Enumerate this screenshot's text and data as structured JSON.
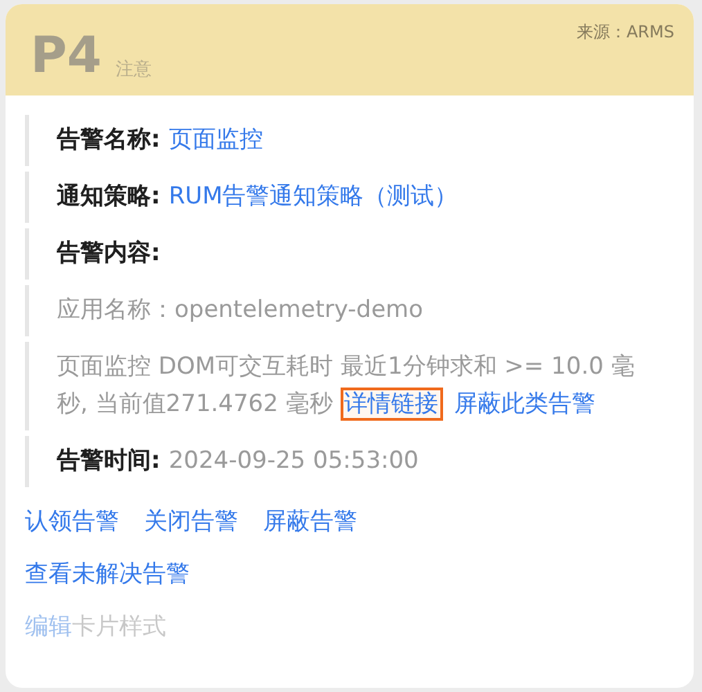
{
  "header": {
    "priority": "P4",
    "severity": "注意",
    "source": "来源：ARMS"
  },
  "fields": [
    {
      "kind": "pair",
      "label": "告警名称:",
      "value": "页面监控",
      "value_is_link": true
    },
    {
      "kind": "pair",
      "label": "通知策略:",
      "value": "RUM告警通知策略（测试）",
      "value_is_link": true
    },
    {
      "kind": "heading",
      "label": "告警内容:"
    },
    {
      "kind": "note",
      "text": "应用名称：opentelemetry-demo"
    },
    {
      "kind": "paragraph",
      "text": "页面监控 DOM可交互耗时 最近1分钟求和 >= 10.0 毫秒, 当前值271.4762 毫秒",
      "links": [
        {
          "label": "详情链接",
          "highlighted": true
        },
        {
          "label": "屏蔽此类告警",
          "highlighted": false
        }
      ]
    },
    {
      "kind": "pair",
      "label": "告警时间:",
      "value": "2024-09-25 05:53:00",
      "value_is_link": false
    }
  ],
  "actions": [
    [
      "认领告警",
      "关闭告警",
      "屏蔽告警"
    ],
    [
      "查看未解决告警"
    ]
  ],
  "footer": {
    "link": "编辑",
    "text": "卡片样式"
  }
}
